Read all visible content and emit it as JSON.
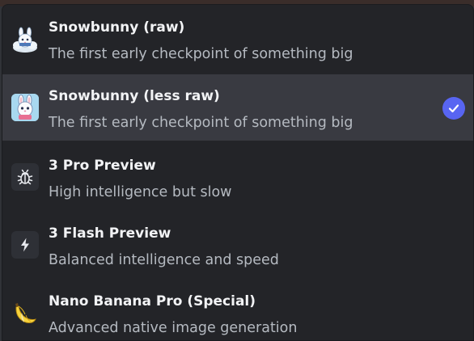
{
  "colors": {
    "menu_background": "#232428",
    "selected_background": "#393a41",
    "title_text": "#f2f3f5",
    "subtitle_text": "#b5bac1",
    "check_accent": "#5865f2"
  },
  "menu": {
    "items": [
      {
        "title": "Snowbunny (raw)",
        "subtitle": "The first early checkpoint of something big",
        "icon": "snow-bunny-cloud-icon",
        "selected": false
      },
      {
        "title": "Snowbunny (less raw)",
        "subtitle": "The first early checkpoint of something big",
        "icon": "bunny-avatar-icon",
        "selected": true
      },
      {
        "title": "3 Pro Preview",
        "subtitle": "High intelligence but slow",
        "icon": "bug-icon",
        "selected": false
      },
      {
        "title": "3 Flash Preview",
        "subtitle": "Balanced intelligence and speed",
        "icon": "lightning-bolt-icon",
        "selected": false
      },
      {
        "title": "Nano Banana Pro (Special)",
        "subtitle": "Advanced native image generation",
        "icon": "banana-icon",
        "selected": false
      }
    ],
    "selected_indicator_icon": "checkmark-circle-icon"
  }
}
